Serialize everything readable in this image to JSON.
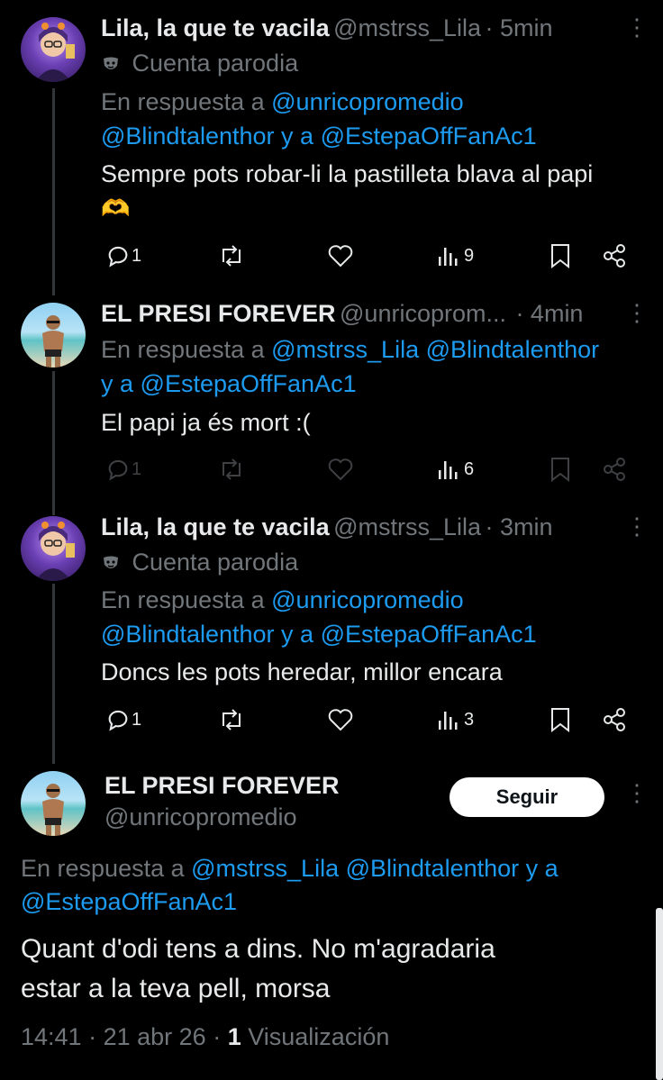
{
  "tweets": [
    {
      "name": "Lila, la que te vacila",
      "handle": "@mstrss_Lila",
      "time": "· 5min",
      "parody": "Cuenta parodia",
      "reply_prefix": "En respuesta a",
      "reply_mention1": "@unricopromedio",
      "reply_mention2": "@Blindtalenthor",
      "reply_and": "y a",
      "reply_mention3": "@EstepaOffFanAc1",
      "text": "Sempre pots robar-li la pastilleta blava al papi",
      "emoji": "🫶",
      "replies": "1",
      "views": "9"
    },
    {
      "name": "EL PRESI FOREVER",
      "handle": "@unricoprom...",
      "time": "· 4min",
      "reply_prefix": "En respuesta a",
      "reply_mention1": "@mstrss_Lila",
      "reply_mention2": "@Blindtalenthor",
      "reply_and": "y a",
      "reply_mention3": "@EstepaOffFanAc1",
      "text": "El papi ja és mort :(",
      "replies": "1",
      "views": "6"
    },
    {
      "name": "Lila, la que te vacila",
      "handle": "@mstrss_Lila",
      "time": "· 3min",
      "parody": "Cuenta parodia",
      "reply_prefix": "En respuesta a",
      "reply_mention1": "@unricopromedio",
      "reply_mention2": "@Blindtalenthor",
      "reply_and": "y a",
      "reply_mention3": "@EstepaOffFanAc1",
      "text": "Doncs les pots heredar, millor encara",
      "replies": "1",
      "views": "3"
    }
  ],
  "main_tweet": {
    "name": "EL PRESI FOREVER",
    "handle": "@unricopromedio",
    "follow_label": "Seguir",
    "reply_prefix": "En respuesta a",
    "reply_mention1": "@mstrss_Lila",
    "reply_mention2": "@Blindtalenthor",
    "reply_and": "y a",
    "reply_mention3": "@EstepaOffFanAc1",
    "text_line1": "Quant d'odi tens a dins. No m'agradaria",
    "text_line2": "estar a la teva pell, morsa",
    "time": "14:41",
    "date": "21 abr 26",
    "views_count": "1",
    "views_label": "Visualización"
  },
  "colors": {
    "background": "#000000",
    "link": "#1d9bf0",
    "muted": "#71767b",
    "text": "#e7e9ea"
  }
}
